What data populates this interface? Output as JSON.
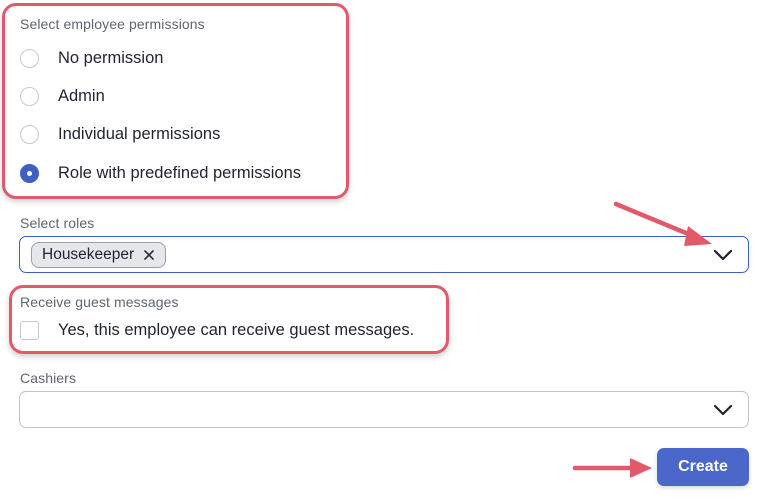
{
  "permissions": {
    "label": "Select employee permissions",
    "options": [
      {
        "label": "No permission",
        "checked": false
      },
      {
        "label": "Admin",
        "checked": false
      },
      {
        "label": "Individual permissions",
        "checked": false
      },
      {
        "label": "Role with predefined permissions",
        "checked": true
      }
    ]
  },
  "roles": {
    "label": "Select roles",
    "selected_tags": [
      "Housekeeper"
    ]
  },
  "guest_messages": {
    "label": "Receive guest messages",
    "checkbox_label": "Yes, this employee can receive guest messages.",
    "checked": false
  },
  "cashiers": {
    "label": "Cashiers",
    "value": ""
  },
  "actions": {
    "create_label": "Create"
  },
  "colors": {
    "accent": "#4a67c9",
    "annotation": "#e3596a"
  },
  "icons": {
    "tag_remove": "close-icon",
    "dropdown": "chevron-down-icon",
    "annotation": "arrow-icon"
  }
}
